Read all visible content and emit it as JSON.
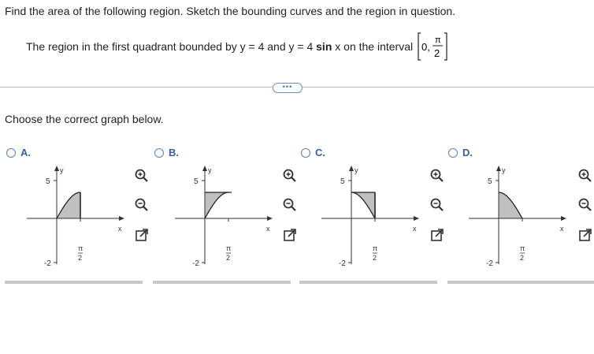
{
  "question": "Find the area of the following region. Sketch the bounding curves and the region in question.",
  "problem": {
    "prefix": "The region in the first quadrant bounded by y = 4 and y = 4",
    "sin": "sin",
    "suffix": "x on the interval",
    "interval_start": "0,",
    "interval_num": "π",
    "interval_den": "2"
  },
  "more_label": "•••",
  "instruction": "Choose the correct graph below.",
  "options": [
    {
      "label": "A.",
      "shading": "under-sine"
    },
    {
      "label": "B.",
      "shading": "above-sine-to-top-line"
    },
    {
      "label": "C.",
      "shading": "triangle-left-descending"
    },
    {
      "label": "D.",
      "shading": "under-cosine"
    }
  ],
  "axis_labels": {
    "y": "y",
    "x": "x",
    "y_tick_top": "5",
    "y_tick_bottom": "-2",
    "x_tick_num": "π",
    "x_tick_den": "2"
  },
  "tools": [
    "zoom-in-icon",
    "zoom-out-icon",
    "external-link-icon"
  ],
  "colors": {
    "accent": "#3560a8",
    "fill": "#c0c0c0"
  }
}
